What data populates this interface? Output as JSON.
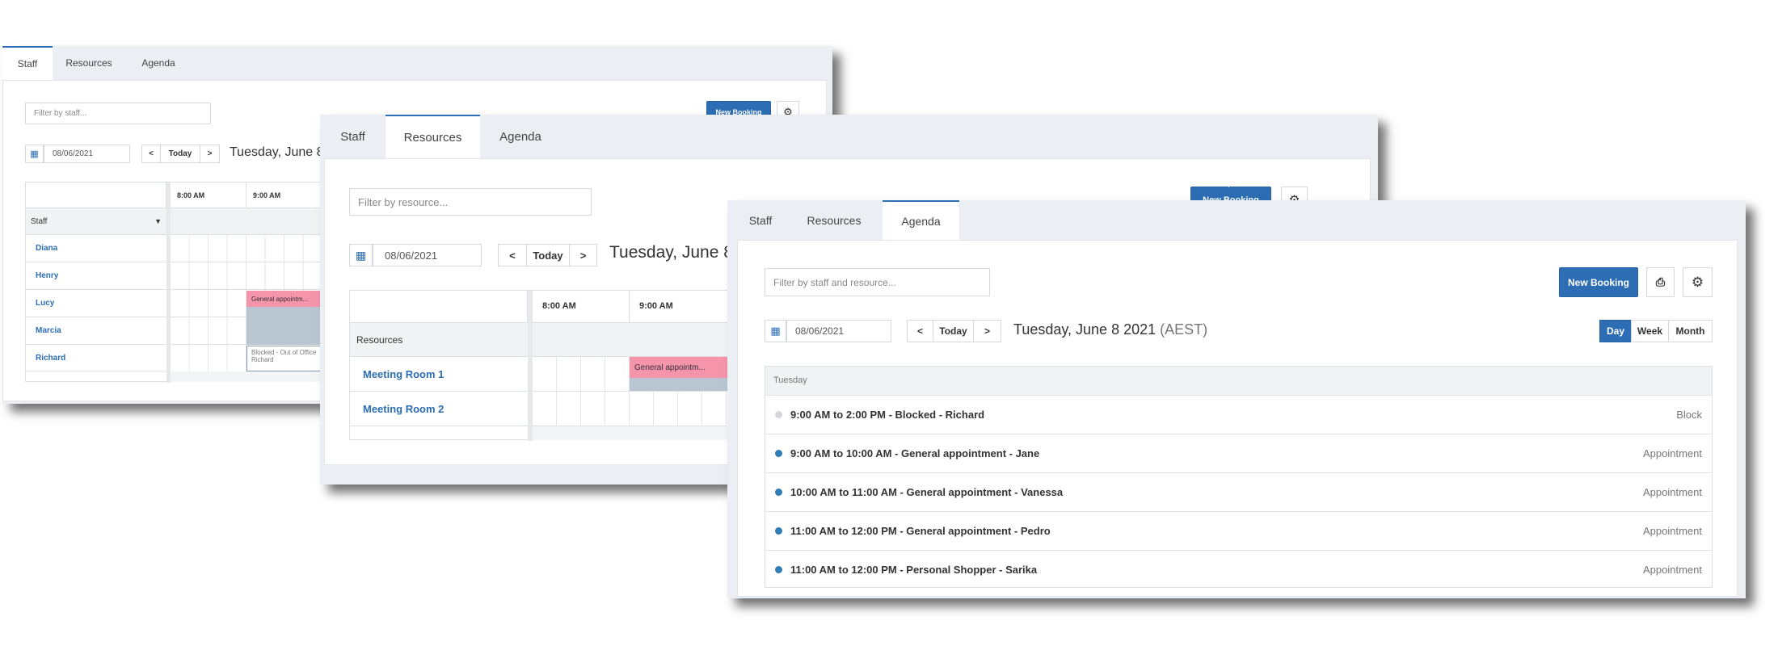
{
  "tabs": [
    "Staff",
    "Resources",
    "Agenda"
  ],
  "colors": {
    "accent": "#2c6db3",
    "appointment": "#f594ab",
    "blocked": "#b9c6d2",
    "dot_appointment": "#2e7db5",
    "dot_block": "#d4d6d9"
  },
  "staff_view": {
    "filter_placeholder": "Filter by staff...",
    "new_booking": "New Booking",
    "date": "08/06/2021",
    "today": "Today",
    "prev": "<",
    "next": ">",
    "title": "Tuesday, June 8 2",
    "hours": [
      "8:00 AM",
      "9:00 AM"
    ],
    "group_header": "Staff",
    "group_caret": "▼",
    "staff": [
      "Diana",
      "Henry",
      "Lucy",
      "Marcia",
      "Richard"
    ],
    "appointment": "General appointm...",
    "blocked_line1": "Blocked - Out of Office",
    "blocked_line2": "Richard"
  },
  "resources_view": {
    "filter_placeholder": "Filter by resource...",
    "new_booking": "New Booking",
    "date": "08/06/2021",
    "today": "Today",
    "prev": "<",
    "next": ">",
    "title": "Tuesday, June 8 2",
    "hours": [
      "8:00 AM",
      "9:00 AM"
    ],
    "group_header": "Resources",
    "resources": [
      "Meeting Room 1",
      "Meeting Room 2"
    ],
    "appointment": "General appointm..."
  },
  "agenda_view": {
    "filter_placeholder": "Filter by staff and resource...",
    "new_booking": "New Booking",
    "date": "08/06/2021",
    "today": "Today",
    "prev": "<",
    "next": ">",
    "title": "Tuesday, June 8 2021",
    "timezone": "(AEST)",
    "view_modes": [
      "Day",
      "Week",
      "Month"
    ],
    "active_mode": "Day",
    "day_header": "Tuesday",
    "events": [
      {
        "text": "9:00 AM to 2:00 PM - Blocked - Richard",
        "type": "Block"
      },
      {
        "text": "9:00 AM to 10:00 AM - General appointment - Jane",
        "type": "Appointment"
      },
      {
        "text": "10:00 AM to 11:00 AM - General appointment - Vanessa",
        "type": "Appointment"
      },
      {
        "text": "11:00 AM to 12:00 PM - General appointment - Pedro",
        "type": "Appointment"
      },
      {
        "text": "11:00 AM to 12:00 PM - Personal Shopper - Sarika",
        "type": "Appointment"
      }
    ]
  }
}
